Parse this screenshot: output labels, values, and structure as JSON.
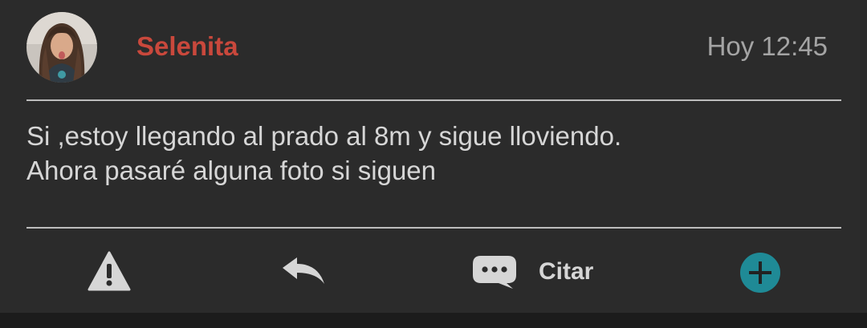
{
  "post": {
    "username": "Selenita",
    "timestamp": "Hoy 12:45",
    "message_lines": [
      "Si ,estoy llegando al prado al 8m y sigue lloviendo.",
      "Ahora pasaré alguna foto si siguen"
    ]
  },
  "actions": {
    "report_icon": "warning-triangle-icon",
    "reply_icon": "reply-arrow-icon",
    "quote_icon": "speech-bubble-icon",
    "quote_label": "Citar",
    "add_icon": "plus-circle-icon"
  },
  "colors": {
    "background": "#2b2b2b",
    "username": "#c9483c",
    "timestamp": "#a4a4a4",
    "text": "#d6d6d6",
    "accent": "#1f8a96"
  }
}
